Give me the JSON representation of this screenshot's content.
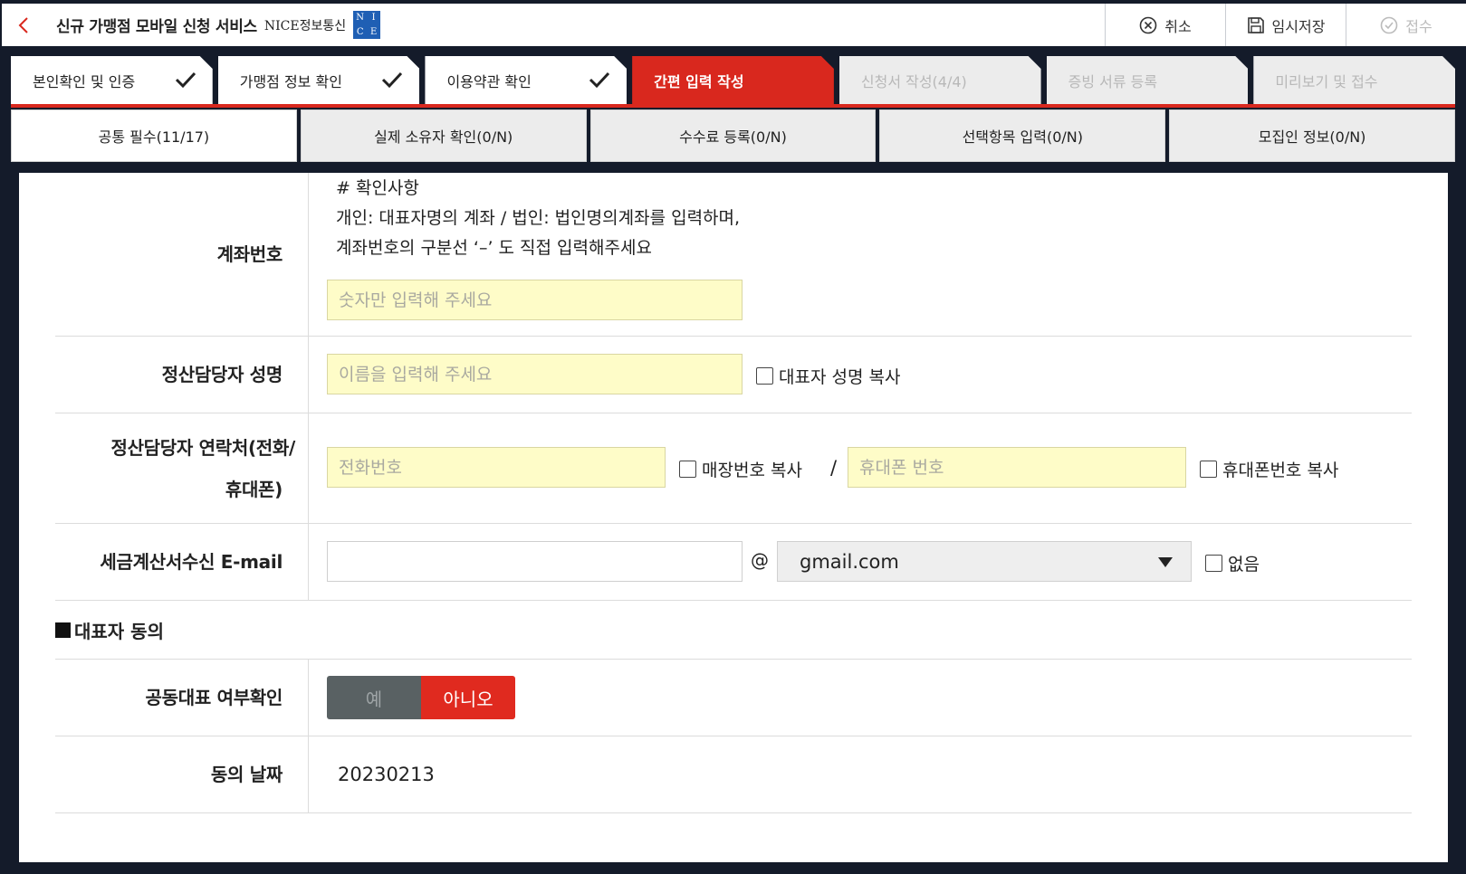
{
  "header": {
    "title": "신규 가맹점 모바일 신청 서비스",
    "brand": "NICE정보통신",
    "logo_letters": [
      "N",
      "I",
      "C",
      "E"
    ],
    "actions": [
      {
        "label": "취소",
        "icon": "cancel-circle-icon"
      },
      {
        "label": "임시저장",
        "icon": "save-icon"
      },
      {
        "label": "접수",
        "icon": "check-circle-icon",
        "disabled": true
      }
    ]
  },
  "steps": [
    {
      "label": "본인확인 및 인증",
      "state": "done"
    },
    {
      "label": "가맹점 정보 확인",
      "state": "done"
    },
    {
      "label": "이용약관 확인",
      "state": "done"
    },
    {
      "label": "간편 입력 작성",
      "state": "active"
    },
    {
      "label": "신청서 작성(4/4)",
      "state": "pending"
    },
    {
      "label": "증빙 서류 등록",
      "state": "pending"
    },
    {
      "label": "미리보기 및 접수",
      "state": "pending"
    }
  ],
  "subtabs": [
    {
      "label": "공통 필수(11/17)",
      "active": true
    },
    {
      "label": "실제 소유자 확인(0/N)"
    },
    {
      "label": "수수료 등록(0/N)"
    },
    {
      "label": "선택항목 입력(0/N)"
    },
    {
      "label": "모집인 정보(0/N)"
    }
  ],
  "form": {
    "account": {
      "label": "계좌번호",
      "note_lines": [
        "# 확인사항",
        "개인: 대표자명의 계좌 / 법인: 법인명의계좌를 입력하며,",
        "계좌번호의 구분선 ‘–’ 도 직접 입력해주세요"
      ],
      "placeholder": "숫자만 입력해 주세요"
    },
    "manager_name": {
      "label": "정산담당자 성명",
      "placeholder": "이름을 입력해 주세요",
      "copy_label": "대표자 성명 복사"
    },
    "manager_contact": {
      "label_line1": "정산담당자 연락처(전화/",
      "label_line2": "휴대폰)",
      "phone_placeholder": "전화번호",
      "phone_copy_label": "매장번호 복사",
      "separator": "/",
      "mobile_placeholder": "휴대폰 번호",
      "mobile_copy_label": "휴대폰번호 복사"
    },
    "email": {
      "label": "세금계산서수신 E-mail",
      "value": "",
      "at": "@",
      "domain": "gmail.com",
      "none_label": "없음"
    },
    "section_title": "대표자 동의",
    "joint_rep": {
      "label": "공동대표 여부확인",
      "yes": "예",
      "no": "아니오",
      "selected": "아니오"
    },
    "consent_date": {
      "label": "동의 날짜",
      "value": "20230213"
    }
  },
  "colors": {
    "accent": "#d9281e",
    "input_bg": "#fefcc8",
    "background": "#141b2a"
  }
}
